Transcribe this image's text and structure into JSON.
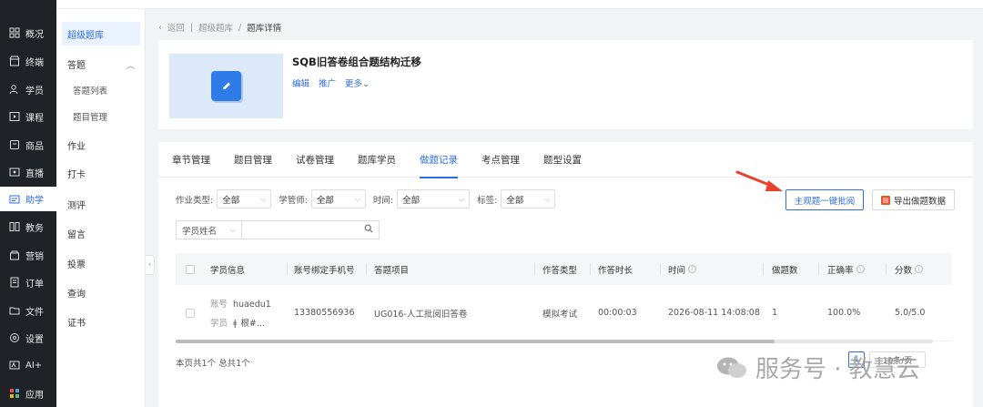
{
  "rail": {
    "items": [
      {
        "label": "概况",
        "icon": "grid-icon"
      },
      {
        "label": "终端",
        "icon": "store-icon"
      },
      {
        "label": "学员",
        "icon": "users-icon"
      },
      {
        "label": "课程",
        "icon": "course-icon"
      },
      {
        "label": "商品",
        "icon": "goods-icon"
      },
      {
        "label": "直播",
        "icon": "live-icon"
      },
      {
        "label": "助学",
        "icon": "study-icon"
      },
      {
        "label": "教务",
        "icon": "academic-icon"
      },
      {
        "label": "营销",
        "icon": "marketing-icon"
      },
      {
        "label": "订单",
        "icon": "order-icon"
      },
      {
        "label": "文件",
        "icon": "folder-icon"
      },
      {
        "label": "设置",
        "icon": "settings-icon"
      },
      {
        "label": "AI+",
        "icon": "ai-icon"
      },
      {
        "label": "应用",
        "icon": "apps-icon"
      }
    ]
  },
  "submenu": {
    "items": [
      {
        "label": "超级题库"
      },
      {
        "label": "答题"
      },
      {
        "label": "答题列表"
      },
      {
        "label": "题目管理"
      },
      {
        "label": "作业"
      },
      {
        "label": "打卡"
      },
      {
        "label": "测评"
      },
      {
        "label": "留言"
      },
      {
        "label": "投票"
      },
      {
        "label": "查询"
      },
      {
        "label": "证书"
      }
    ]
  },
  "breadcrumb": {
    "back": "返回",
    "parent": "超级题库",
    "sep": "/",
    "current": "题库详情"
  },
  "header": {
    "title": "SQB旧答卷组合题结构迁移",
    "actions": [
      "编辑",
      "推广",
      "更多"
    ]
  },
  "tabs": [
    "章节管理",
    "题目管理",
    "试卷管理",
    "题库学员",
    "做题记录",
    "考点管理",
    "题型设置"
  ],
  "filters": [
    {
      "label": "作业类型:",
      "value": "全部"
    },
    {
      "label": "学管师:",
      "value": "全部"
    },
    {
      "label": "时间:",
      "value": "全部"
    },
    {
      "label": "标签:",
      "value": "全部"
    }
  ],
  "buttons": {
    "batch_grade": "主观题一键批阅",
    "export": "导出做题数据"
  },
  "search": {
    "field": "学员姓名",
    "placeholder": ""
  },
  "table": {
    "headers": [
      "学员信息",
      "账号绑定手机号",
      "答题项目",
      "作答类型",
      "作答时长",
      "时间",
      "做题数",
      "正确率",
      "分数"
    ],
    "rows": [
      {
        "account_label": "账号",
        "account": "huaedu1",
        "student_label": "学员",
        "student": "根#...",
        "phone": "13380556936",
        "project": "UG016-人工批阅旧答卷",
        "type": "模拟考试",
        "duration": "00:00:03",
        "time": "2026-08-11 14:08:08",
        "count": "1",
        "accuracy": "100.0%",
        "score": "5.0/5.0"
      }
    ]
  },
  "footer": {
    "summary": "本页共1个 总共1个",
    "page": "1",
    "page_size": "10条/页"
  },
  "watermark": {
    "text": "服务号 · 教慧云"
  },
  "colors": {
    "accent": "#2f6ce5",
    "rail": "#1f2227",
    "annotation": "#e8412c"
  }
}
